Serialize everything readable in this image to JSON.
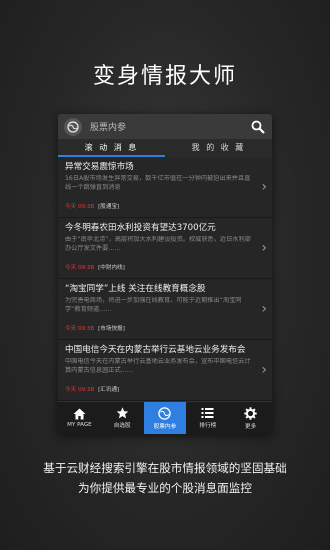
{
  "hero_title": "变身情报大师",
  "search": {
    "placeholder": "股票内参"
  },
  "tabs": [
    {
      "label": "滚 动 消 息",
      "active": true
    },
    {
      "label": "我 的 收 藏",
      "active": false
    }
  ],
  "news": [
    {
      "title": "异常交易震惊市场",
      "desc": "16日A股市场发生异常交易，数千亿市值在一分钟内被迫出来并且直线一个跳弹直到消息",
      "time": "今天 09:38",
      "source": "[股通宝]"
    },
    {
      "title": "今冬明春农田水利投资有望达3700亿元",
      "desc": "由于“南旱北涝”，高层将加大水利建设投资。权威获悉，近日水利部办公厅发文件要……",
      "time": "今天 09:38",
      "source": "[中财内线]"
    },
    {
      "title": "“淘宝同学”上线 关注在线教育概念股",
      "desc": "为完善电商场，将进一步加强在线教育。可能于近期推出“淘宝同学”教育频道……",
      "time": "今天 09:38",
      "source": "[市场快报]"
    },
    {
      "title": "中国电信今天在内蒙古举行云基地云业务发布会",
      "desc": "中国电信今天在内蒙古举行云基地云业务发布会，宣布中国电信云计算内蒙古信息园正式……",
      "time": "今天 09:38",
      "source": "[汇讯通]"
    }
  ],
  "bottom_nav": [
    {
      "label": "MY PAGE",
      "icon": "home-icon",
      "active": false
    },
    {
      "label": "自选股",
      "icon": "star-icon",
      "active": false
    },
    {
      "label": "股票内参",
      "icon": "globe-icon",
      "active": true
    },
    {
      "label": "排行榜",
      "icon": "list-icon",
      "active": false
    },
    {
      "label": "更多",
      "icon": "gear-icon",
      "active": false
    }
  ],
  "caption": {
    "line1": "基于云财经搜索引擎在股市情报领域的坚固基础",
    "line2": "为你提供最专业的个股消息面监控"
  },
  "colors": {
    "accent": "#2f7fe0",
    "time_red": "#e23b3b"
  }
}
